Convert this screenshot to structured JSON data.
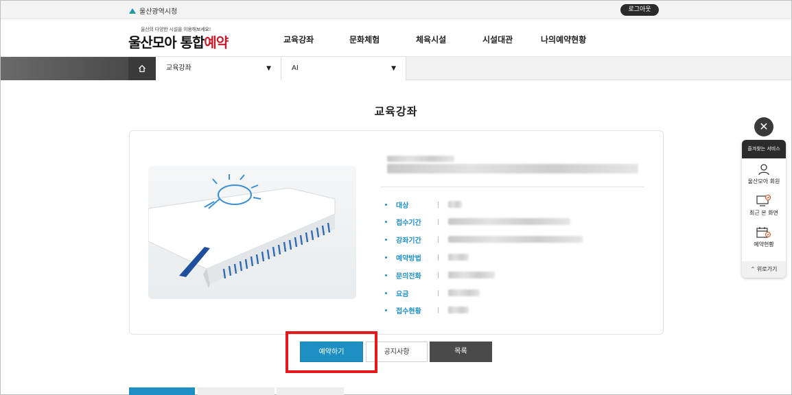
{
  "topbar": {
    "city": "울산광역시청",
    "logout_label": "로그아웃"
  },
  "brand": {
    "tagline": "울산의 다양한 시설을 이용해보세요!",
    "name_main": "울산모아 통합",
    "name_accent": "예약"
  },
  "nav": {
    "items": [
      "교육강좌",
      "문화체험",
      "체육시설",
      "시설대관",
      "나의예약현황"
    ]
  },
  "breadcrumb": {
    "category": "교육강좌",
    "filter": "AI"
  },
  "page": {
    "title": "교육강좌"
  },
  "course": {
    "fields": [
      {
        "label": "대상"
      },
      {
        "label": "접수기간"
      },
      {
        "label": "강좌기간"
      },
      {
        "label": "예약방법"
      },
      {
        "label": "문의전화"
      },
      {
        "label": "요금"
      },
      {
        "label": "접수현황"
      }
    ]
  },
  "actions": {
    "reserve": "예약하기",
    "notice": "공지사항",
    "list": "목록"
  },
  "quickmenu": {
    "header": "즐겨찾는 서비스",
    "items": [
      {
        "label": "울산모아 회원",
        "icon": "person-icon"
      },
      {
        "label": "최근 본 화면",
        "icon": "monitor-icon"
      },
      {
        "label": "예약현황",
        "icon": "calendar-icon"
      }
    ],
    "top_label": "위로가기"
  },
  "colors": {
    "accent": "#1e8fc2",
    "highlight": "#e51919",
    "brand_red": "#c7192a"
  }
}
